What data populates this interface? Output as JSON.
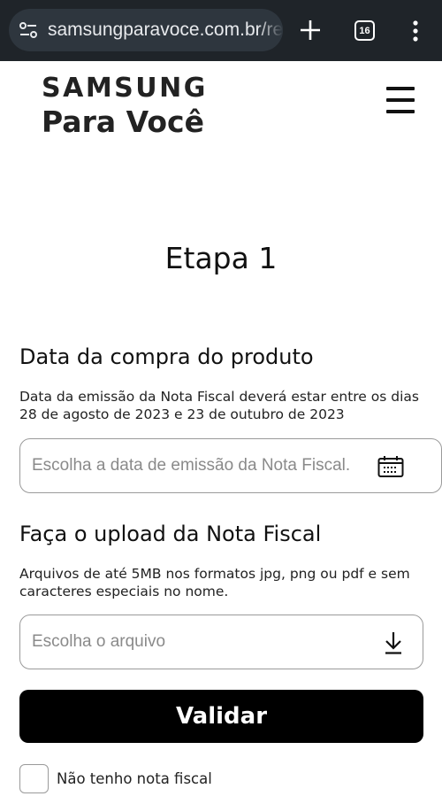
{
  "browser": {
    "url": "samsungparavoce.com.br/reso",
    "tab_count": "16"
  },
  "header": {
    "logo_brand": "SAMSUNG",
    "logo_sub": "Para Você"
  },
  "page": {
    "step_title": "Etapa 1"
  },
  "purchase_date": {
    "heading": "Data da compra do produto",
    "help": "Data da emissão da Nota Fiscal deverá estar entre os dias 28 de agosto de 2023 e 23 de outubro de 2023",
    "placeholder": "Escolha a data de emissão da Nota Fiscal."
  },
  "upload": {
    "heading": "Faça o upload da Nota Fiscal",
    "help": "Arquivos de até 5MB nos formatos jpg, png ou pdf e sem caracteres especiais no nome.",
    "placeholder": "Escolha o arquivo"
  },
  "actions": {
    "validate_label": "Validar",
    "no_invoice_label": "Não tenho nota fiscal"
  },
  "icons": {
    "site_settings": "site-settings-icon",
    "new_tab": "plus-icon",
    "tabs": "tabs-icon",
    "menu": "menu-dots-icon",
    "hamburger": "hamburger-icon",
    "calendar": "calendar-icon",
    "download": "download-icon"
  }
}
